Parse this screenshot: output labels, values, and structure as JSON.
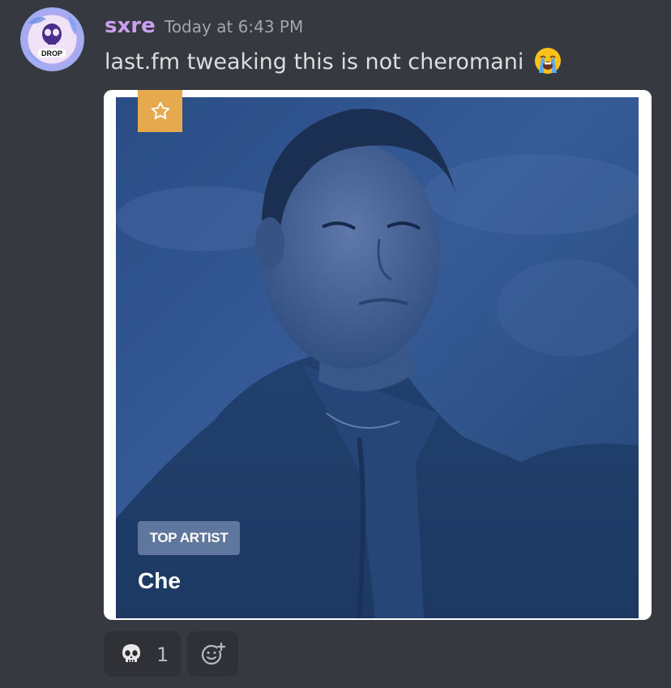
{
  "message": {
    "author": "sxre",
    "timestamp": "Today at 6:43 PM",
    "content": "last.fm tweaking this is not cheromani",
    "content_emoji": "loudly-crying-face-emoji",
    "avatar_text": "DROP"
  },
  "embed": {
    "badge_label": "TOP ARTIST",
    "artist_name": "Che",
    "star_icon": "star-icon",
    "colors": {
      "star_badge": "#e7a94e",
      "image_tint": "#2c4f88"
    }
  },
  "reactions": [
    {
      "emoji": "skull-emoji",
      "count": "1"
    }
  ],
  "add_reaction_icon": "add-reaction-icon",
  "colors": {
    "background": "#36393f",
    "username": "#c9a0f0",
    "text": "#dcddde",
    "timestamp": "#a3a6aa"
  }
}
